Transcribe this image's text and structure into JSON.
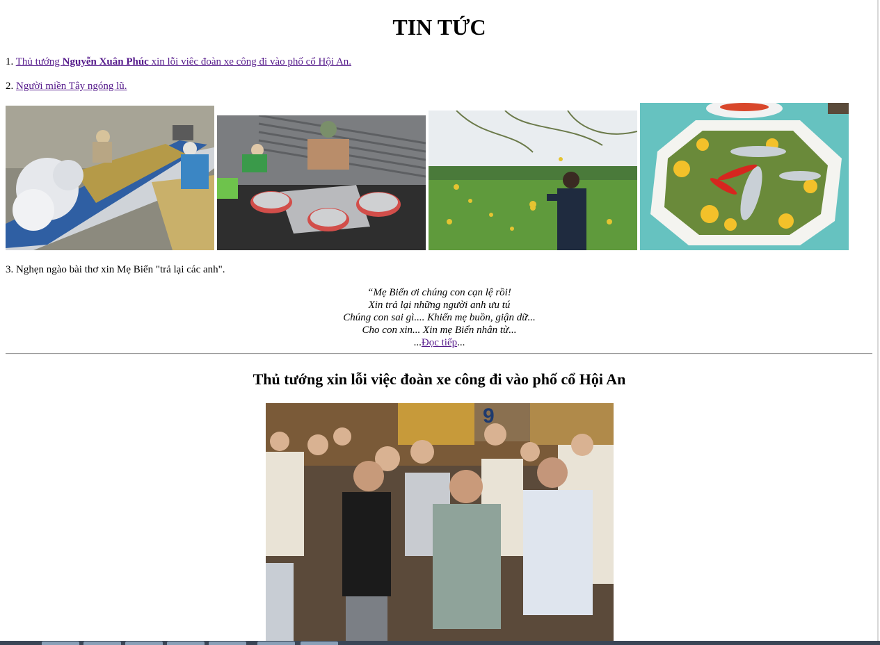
{
  "page": {
    "title": "TIN TỨC"
  },
  "news": [
    {
      "num": "1. ",
      "link_pre": "Thủ tướng ",
      "link_bold": "Nguyễn Xuân Phúc",
      "link_post": " xin lỗi viêc đoàn xe công đi vào phố cổ Hội An."
    },
    {
      "num": "2. ",
      "link": "Người miền Tây ngóng lũ."
    },
    {
      "num": "3. ",
      "text": "Nghẹn ngào bài thơ xin Mẹ Biển \"trả lại các anh\"."
    }
  ],
  "gallery": [
    {
      "icon": "photo-boat-water-lilies",
      "alt": "Boat loaded with water lilies"
    },
    {
      "icon": "photo-fish-baskets",
      "alt": "Baskets of small fish on a boat"
    },
    {
      "icon": "photo-sesbania-flowers",
      "alt": "Man picking yellow flowers"
    },
    {
      "icon": "photo-fish-dish",
      "alt": "Dish of fish with yellow flowers"
    }
  ],
  "poem": {
    "lines": [
      "“Mẹ Biển ơi chúng con cạn lệ rồi!",
      "Xin trả lại những người anh ưu tú",
      "Chúng con sai gì.... Khiến mẹ buồn, giận dữ...",
      "Cho con xin... Xin mẹ Biển nhân từ..."
    ],
    "more_prefix": "...",
    "more_link": "Đọc tiếp",
    "more_suffix": "..."
  },
  "article": {
    "title": "Thủ tướng xin lỗi việc đoàn xe công đi vào phố cổ Hội An",
    "photo_icon": "photo-prime-minister-crowd"
  },
  "colors": {
    "link": "#551a8b",
    "text": "#000000",
    "background": "#ffffff",
    "taskbar": "#3a4656"
  }
}
